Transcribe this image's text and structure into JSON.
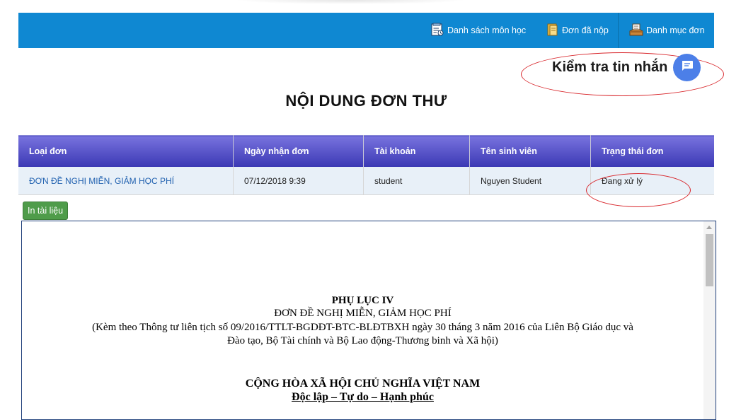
{
  "nav": {
    "items": [
      {
        "label": "Danh sách môn học",
        "icon": "document-list-icon"
      },
      {
        "label": "Đơn đã nộp",
        "icon": "folder-icon"
      },
      {
        "label": "Danh mục đơn",
        "icon": "inbox-tray-icon"
      }
    ]
  },
  "messages": {
    "label": "Kiểm tra tin nhắn",
    "icon": "chat-bubble-icon"
  },
  "page_title": "NỘI DUNG ĐƠN THƯ",
  "table": {
    "headers": [
      "Loại đơn",
      "Ngày nhận đơn",
      "Tài khoản",
      "Tên sinh viên",
      "Trạng thái đơn"
    ],
    "row": {
      "type": "ĐƠN ĐỀ NGHỊ MIỄN, GIẢM HỌC PHÍ",
      "date": "07/12/2018 9:39",
      "account": "student",
      "student_name": "Nguyen Student",
      "status": "Đang xử lý"
    }
  },
  "print_button": "In tài liệu",
  "document": {
    "appendix": "PHỤ LỤC IV",
    "form_name": "ĐƠN ĐỀ NGHỊ MIỄN, GIẢM HỌC PHÍ",
    "reference_line1": "(Kèm theo Thông tư liên tịch số 09/2016/TTLT-BGDĐT-BTC-BLĐTBXH ngày 30 tháng 3 năm 2016 của Liên Bộ Giáo dục và",
    "reference_line2": "Đào tạo, Bộ Tài chính và Bộ Lao động-Thương binh và Xã hội)",
    "nation": "CỘNG HÒA XÃ HỘI CHỦ NGHĨA VIỆT NAM",
    "motto": "Độc lập – Tự do – Hạnh phúc"
  },
  "colors": {
    "navbar": "#0f88d2",
    "header_gradient_top": "#7873de",
    "header_gradient_bottom": "#3b38b4",
    "row_background": "#e8f0f8",
    "link": "#2262b0",
    "print_button": "#4f9c4a",
    "annotation": "#d8262b",
    "chat_button": "#4c7fe8"
  }
}
